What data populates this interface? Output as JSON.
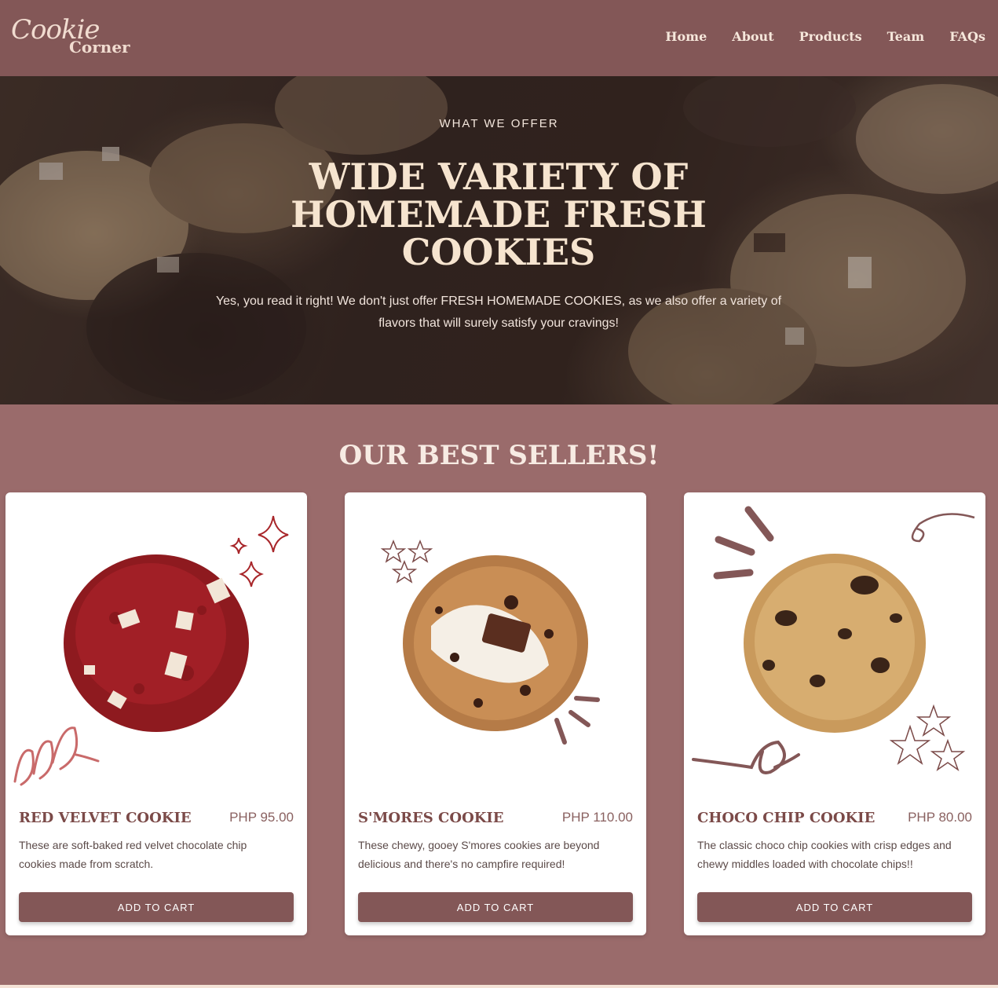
{
  "header": {
    "logo_script": "Cookie",
    "logo_bold": "Corner",
    "nav": [
      "Home",
      "About",
      "Products",
      "Team",
      "FAQs"
    ]
  },
  "hero": {
    "eyebrow": "WHAT WE OFFER",
    "title": "WIDE VARIETY OF HOMEMADE FRESH COOKIES",
    "description": "Yes, you read it right! We don't just offer FRESH HOMEMADE COOKIES, as we also offer a variety of flavors that will surely satisfy your cravings!"
  },
  "best_sellers": {
    "title": "OUR BEST SELLERS!",
    "cards": [
      {
        "name": "RED VELVET COOKIE",
        "price": "PHP 95.00",
        "description": "These are soft-baked red velvet chocolate chip cookies made from scratch.",
        "button": "ADD TO CART"
      },
      {
        "name": "S'MORES COOKIE",
        "price": "PHP 110.00",
        "description": "These chewy, gooey S'mores cookies are beyond delicious and there's no campfire required!",
        "button": "ADD TO CART"
      },
      {
        "name": "CHOCO CHIP COOKIE",
        "price": "PHP 80.00",
        "description": "The classic choco chip cookies with crisp edges and chewy middles loaded with chocolate chips!!",
        "button": "ADD TO CART"
      }
    ]
  },
  "colors": {
    "header_bg": "#835757",
    "page_bg": "#9a6b6b",
    "title_cream": "#f6e4cf",
    "card_title": "#7b4a48",
    "button_bg": "#835757"
  }
}
